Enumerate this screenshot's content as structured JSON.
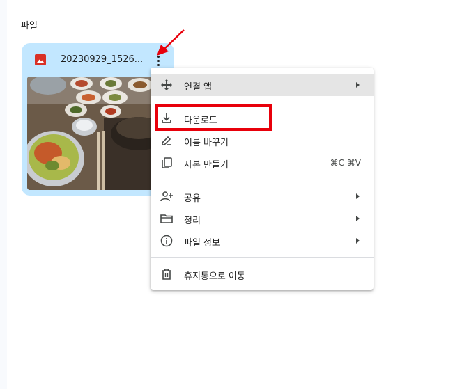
{
  "section": {
    "title": "파일"
  },
  "file_card": {
    "name": "20230929_1526...",
    "type_icon": "image-icon",
    "more_icon": "more-vertical-icon",
    "icon_color": "#d93025"
  },
  "menu": {
    "items": [
      {
        "label": "연결 앱",
        "icon": "open-with-icon",
        "submenu": true
      },
      {
        "label": "다운로드",
        "icon": "download-icon"
      },
      {
        "label": "이름 바꾸기",
        "icon": "rename-icon"
      },
      {
        "label": "사본 만들기",
        "icon": "copy-icon",
        "shortcut": "⌘C ⌘V"
      },
      {
        "label": "공유",
        "icon": "share-icon",
        "submenu": true
      },
      {
        "label": "정리",
        "icon": "folder-icon",
        "submenu": true
      },
      {
        "label": "파일 정보",
        "icon": "info-icon",
        "submenu": true
      },
      {
        "label": "휴지통으로 이동",
        "icon": "trash-icon"
      }
    ]
  },
  "annotations": {
    "arrow_color": "#e8000b",
    "highlight_color": "#e8000b"
  }
}
